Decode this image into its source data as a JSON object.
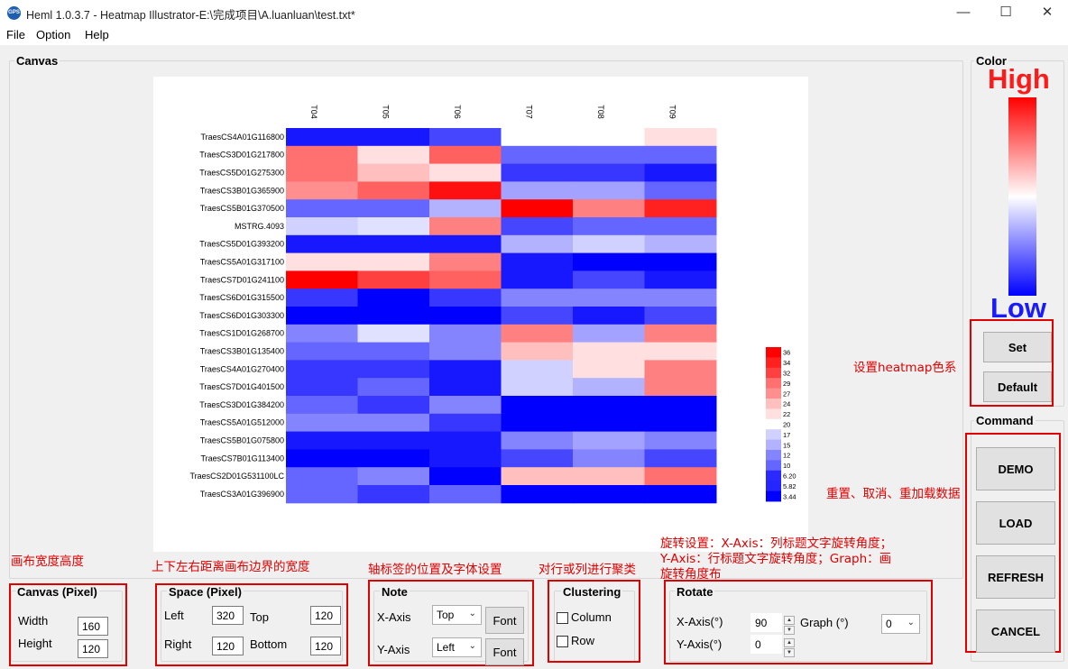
{
  "window": {
    "title": "Heml 1.0.3.7 - Heatmap Illustrator-E:\\完成项目\\A.luanluan\\test.txt*",
    "app_icon": "GPS"
  },
  "menu": [
    "File",
    "Option",
    "Help"
  ],
  "canvas_group": {
    "title": "Canvas"
  },
  "color_group": {
    "title": "Color",
    "high_label": "High",
    "low_label": "Low",
    "set_label": "Set",
    "default_label": "Default",
    "high_color": "#ff0000",
    "low_color": "#0000ff"
  },
  "command_group": {
    "title": "Command",
    "buttons": [
      "DEMO",
      "LOAD",
      "REFRESH",
      "CANCEL"
    ]
  },
  "annotations": {
    "color": "设置heatmap色系",
    "command": "重置、取消、重加载数据",
    "canvas": "画布宽度高度",
    "space": "上下左右距离画布边界的宽度",
    "note": "轴标签的位置及字体设置",
    "clustering": "对行或列进行聚类",
    "rotate_line1": "旋转设置：X-Axis：列标题文字旋转角度；",
    "rotate_line2": "Y-Axis：行标题文字旋转角度；Graph：画",
    "rotate_line3": "旋转角度布"
  },
  "canvas_pixel": {
    "title": "Canvas (Pixel)",
    "width_label": "Width",
    "width_value": "160",
    "height_label": "Height",
    "height_value": "120"
  },
  "space_pixel": {
    "title": "Space (Pixel)",
    "left_label": "Left",
    "left_value": "320",
    "top_label": "Top",
    "top_value": "120",
    "right_label": "Right",
    "right_value": "120",
    "bottom_label": "Bottom",
    "bottom_value": "120"
  },
  "note": {
    "title": "Note",
    "x_label": "X-Axis",
    "x_value": "Top",
    "y_label": "Y-Axis",
    "y_value": "Left",
    "font_label": "Font"
  },
  "clustering": {
    "title": "Clustering",
    "column_label": "Column",
    "row_label": "Row",
    "column_checked": false,
    "row_checked": false
  },
  "rotate": {
    "title": "Rotate",
    "x_label": "X-Axis(°)",
    "x_value": "90",
    "y_label": "Y-Axis(°)",
    "y_value": "0",
    "graph_label": "Graph (°)",
    "graph_value": "0"
  },
  "chart_data": {
    "type": "heatmap",
    "columns": [
      "T04",
      "T05",
      "T06",
      "T07",
      "T08",
      "T09"
    ],
    "rows": [
      "TraesCS4A01G116800",
      "TraesCS3D01G217800",
      "TraesCS5D01G275300",
      "TraesCS3B01G365900",
      "TraesCS5B01G370500",
      "MSTRG.4093",
      "TraesCS5D01G393200",
      "TraesCS5A01G317100",
      "TraesCS7D01G241100",
      "TraesCS6D01G315500",
      "TraesCS6D01G303300",
      "TraesCS1D01G268700",
      "TraesCS3B01G135400",
      "TraesCS4A01G270400",
      "TraesCS7D01G401500",
      "TraesCS3D01G384200",
      "TraesCS5A01G512000",
      "TraesCS5B01G075800",
      "TraesCS7B01G113400",
      "TraesCS2D01G531100LC",
      "TraesCS3A01G396900"
    ],
    "values": [
      [
        5,
        5,
        8,
        20,
        20,
        22
      ],
      [
        29,
        22,
        30,
        10,
        10,
        10
      ],
      [
        29,
        24,
        22,
        7,
        7,
        5
      ],
      [
        27,
        30,
        35,
        14,
        14,
        10
      ],
      [
        10,
        10,
        15,
        36,
        28,
        34
      ],
      [
        17,
        18,
        28,
        8,
        10,
        10
      ],
      [
        5,
        5,
        5,
        15,
        17,
        15
      ],
      [
        22,
        22,
        28,
        5,
        3.44,
        3.44
      ],
      [
        36,
        32,
        30,
        5,
        8,
        5
      ],
      [
        7,
        3.44,
        7,
        12,
        12,
        12
      ],
      [
        3.44,
        3.44,
        3.44,
        8,
        5,
        8
      ],
      [
        12,
        18,
        12,
        28,
        14,
        28
      ],
      [
        10,
        10,
        12,
        24,
        22,
        22
      ],
      [
        7,
        7,
        5,
        17,
        22,
        28
      ],
      [
        7,
        10,
        5,
        17,
        15,
        28
      ],
      [
        10,
        7,
        12,
        3.44,
        3.44,
        3.44
      ],
      [
        12,
        12,
        7,
        3.44,
        3.44,
        3.44
      ],
      [
        5,
        5,
        5,
        12,
        14,
        12
      ],
      [
        3.44,
        3.44,
        5,
        8,
        12,
        8
      ],
      [
        10,
        12,
        3.44,
        24,
        24,
        29
      ],
      [
        10,
        7,
        10,
        3.44,
        3.44,
        3.44
      ]
    ],
    "legend_labels": [
      "36",
      "34",
      "32",
      "29",
      "27",
      "24",
      "22",
      "20",
      "17",
      "15",
      "12",
      "10",
      "6.20",
      "5.82",
      "3.44"
    ],
    "vmin": 3.44,
    "vmid": 20,
    "vmax": 36
  }
}
